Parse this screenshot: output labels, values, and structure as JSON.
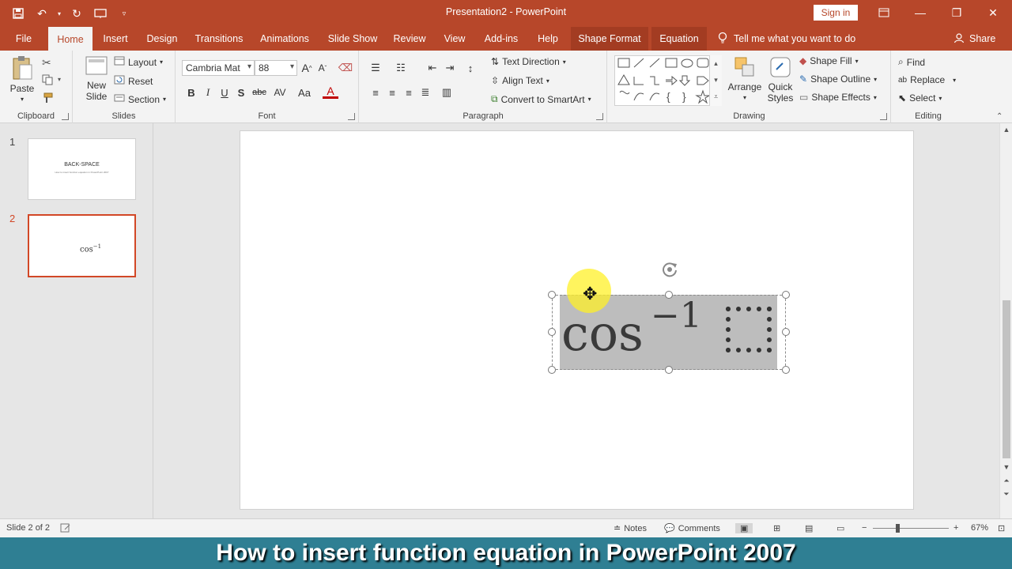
{
  "window": {
    "title": "Presentation2  -  PowerPoint",
    "sign_in": "Sign in"
  },
  "tabs": [
    {
      "label": "File"
    },
    {
      "label": "Home"
    },
    {
      "label": "Insert"
    },
    {
      "label": "Design"
    },
    {
      "label": "Transitions"
    },
    {
      "label": "Animations"
    },
    {
      "label": "Slide Show"
    },
    {
      "label": "Review"
    },
    {
      "label": "View"
    },
    {
      "label": "Add-ins"
    },
    {
      "label": "Help"
    },
    {
      "label": "Shape Format"
    },
    {
      "label": "Equation"
    }
  ],
  "tell_me": "Tell me what you want to do",
  "share": "Share",
  "clipboard": {
    "paste": "Paste",
    "group": "Clipboard"
  },
  "slides_group": {
    "new_slide_1": "New",
    "new_slide_2": "Slide",
    "layout": "Layout",
    "reset": "Reset",
    "section": "Section",
    "group": "Slides"
  },
  "font": {
    "name": "Cambria Mat",
    "size": "88",
    "group": "Font",
    "bold": "B",
    "italic": "I",
    "underline": "U",
    "shadow": "S",
    "strike": "abc",
    "spacing": "AV",
    "case": "Aa",
    "color": "A"
  },
  "paragraph": {
    "text_direction": "Text Direction",
    "align_text": "Align Text",
    "convert_smartart": "Convert to SmartArt",
    "group": "Paragraph"
  },
  "drawing": {
    "arrange": "Arrange",
    "quick_1": "Quick",
    "quick_2": "Styles",
    "shape_fill": "Shape Fill",
    "shape_outline": "Shape Outline",
    "shape_effects": "Shape Effects",
    "group": "Drawing"
  },
  "editing": {
    "find": "Find",
    "replace": "Replace",
    "select": "Select",
    "group": "Editing"
  },
  "thumbnails": [
    {
      "number": "1",
      "title": "BACK-SPACE",
      "subtitle": "How to insert function equation in PowerPoint 2007"
    },
    {
      "number": "2",
      "content": "cos",
      "sup": "−1"
    }
  ],
  "equation": {
    "base": "cos",
    "sup": "−1"
  },
  "status": {
    "slide": "Slide 2 of 2",
    "notes": "Notes",
    "comments": "Comments",
    "zoom": "67%"
  },
  "caption": "How to insert function equation in PowerPoint 2007",
  "colors": {
    "brand": "#b7472a",
    "selected_thumb": "#d24726",
    "caption_bg": "#2f7f93"
  }
}
